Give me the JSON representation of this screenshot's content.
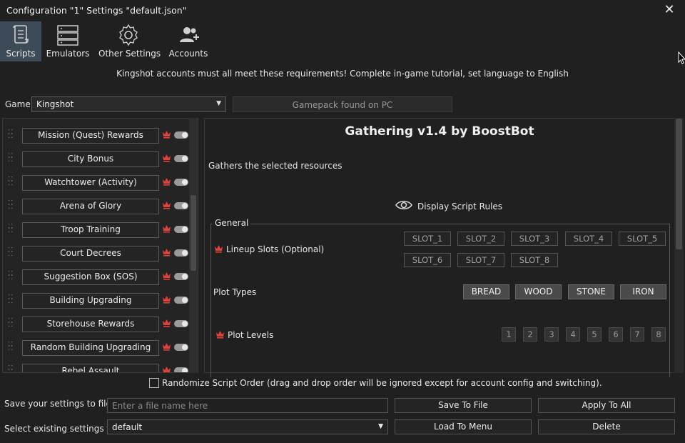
{
  "window": {
    "title": "Configuration \"1\" Settings \"default.json\""
  },
  "tabs": [
    {
      "label": "Scripts",
      "icon": "scroll-icon",
      "active": true
    },
    {
      "label": "Emulators",
      "icon": "server-icon"
    },
    {
      "label": "Other Settings",
      "icon": "gear-icon"
    },
    {
      "label": "Accounts",
      "icon": "users-add-icon"
    }
  ],
  "notice": "Kingshot accounts must all meet these requirements! Complete in-game tutorial, set language to English",
  "game": {
    "label": "Game:",
    "value": "Kingshot",
    "status": "Gamepack found on PC"
  },
  "scripts": [
    "Mission (Quest) Rewards",
    "City Bonus",
    "Watchtower (Activity)",
    "Arena of Glory",
    "Troop Training",
    "Court Decrees",
    "Suggestion Box (SOS)",
    "Building Upgrading",
    "Storehouse Rewards",
    "Random Building Upgrading",
    "Rebel Assault"
  ],
  "detail": {
    "title": "Gathering v1.4 by BoostBot",
    "description": "Gathers the selected resources",
    "rules_button": "Display Script Rules",
    "group_label": "General",
    "lineup_label": "Lineup Slots (Optional)",
    "slots": [
      "SLOT_1",
      "SLOT_2",
      "SLOT_3",
      "SLOT_4",
      "SLOT_5",
      "SLOT_6",
      "SLOT_7",
      "SLOT_8"
    ],
    "plot_types_label": "Plot Types",
    "plot_types": [
      "BREAD",
      "WOOD",
      "STONE",
      "IRON"
    ],
    "plot_levels_label": "Plot Levels",
    "plot_levels": [
      "1",
      "2",
      "3",
      "4",
      "5",
      "6",
      "7",
      "8"
    ]
  },
  "randomize_label": "Randomize Script Order (drag and drop order will be ignored except for account config and switching).",
  "footer": {
    "save_label": "Save your settings to file",
    "file_placeholder": "Enter a file name here",
    "select_label": "Select existing settings file",
    "selected_file": "default",
    "save_button": "Save To File",
    "apply_button": "Apply To All",
    "load_button": "Load To Menu",
    "delete_button": "Delete"
  },
  "colors": {
    "background": "#202020",
    "active_tab": "#3d4a57",
    "crown": "#e0413a"
  }
}
